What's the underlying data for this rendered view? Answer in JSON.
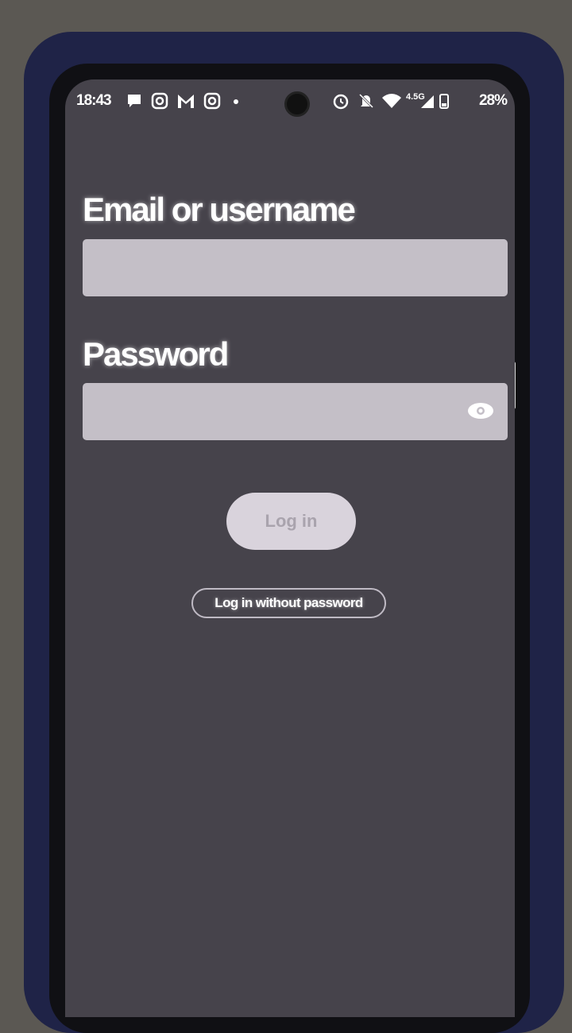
{
  "status_bar": {
    "time": "18:43",
    "network": "4.5G",
    "battery": "28%",
    "left_icons": [
      "chat-icon",
      "instagram-icon",
      "gmail-icon",
      "instagram-icon",
      "dot-icon"
    ],
    "right_icons": [
      "alarm-icon",
      "mute-icon",
      "wifi-icon",
      "signal-icon",
      "battery-icon"
    ]
  },
  "login_form": {
    "email_label": "Email or username",
    "email_value": "",
    "password_label": "Password",
    "password_value": "",
    "login_button": "Log in",
    "login_without_password_button": "Log in without password"
  },
  "colors": {
    "background": "#46434b",
    "input_fill": "#c4bfc7",
    "button_fill": "#d9d3dc",
    "button_text": "#a9a3ad"
  }
}
